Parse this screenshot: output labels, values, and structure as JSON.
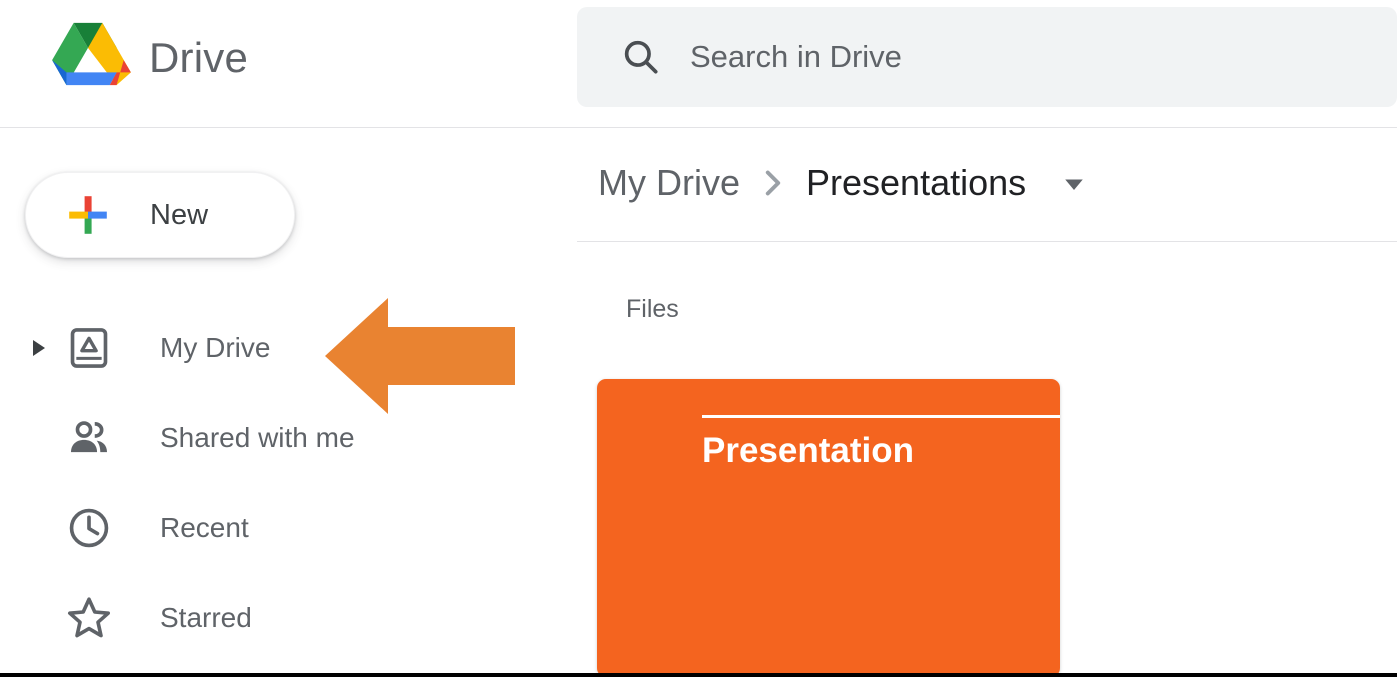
{
  "app": {
    "brand_name": "Drive",
    "logo_icon": "google-drive-logo"
  },
  "search": {
    "icon": "search-icon",
    "placeholder": "Search in Drive",
    "value": "",
    "background": "#f1f3f4"
  },
  "sidebar": {
    "new_button": {
      "label": "New",
      "icon": "google-plus-icon"
    },
    "callout": {
      "shape": "left-arrow",
      "color": "#e98331",
      "points_to": "new-button"
    },
    "items": [
      {
        "label": "My Drive",
        "icon": "my-drive-icon",
        "expander": "triangle-right-icon",
        "expandable": true
      },
      {
        "label": "Shared with me",
        "icon": "people-icon",
        "expandable": false
      },
      {
        "label": "Recent",
        "icon": "clock-icon",
        "expandable": false
      },
      {
        "label": "Starred",
        "icon": "star-outline-icon",
        "expandable": false
      }
    ]
  },
  "content": {
    "breadcrumb": {
      "root": "My Drive",
      "separator_icon": "chevron-right-icon",
      "current": "Presentations",
      "caret_icon": "chevron-down-icon"
    },
    "section_title": "Files",
    "files": [
      {
        "title": "Presentation",
        "color": "#f4641f",
        "type": "presentation-thumbnail"
      }
    ]
  },
  "colors": {
    "accent_orange": "#f4641f",
    "callout_orange": "#e98331",
    "text_primary": "#202124",
    "text_secondary": "#5f6368",
    "divider": "#e3e3e6"
  }
}
